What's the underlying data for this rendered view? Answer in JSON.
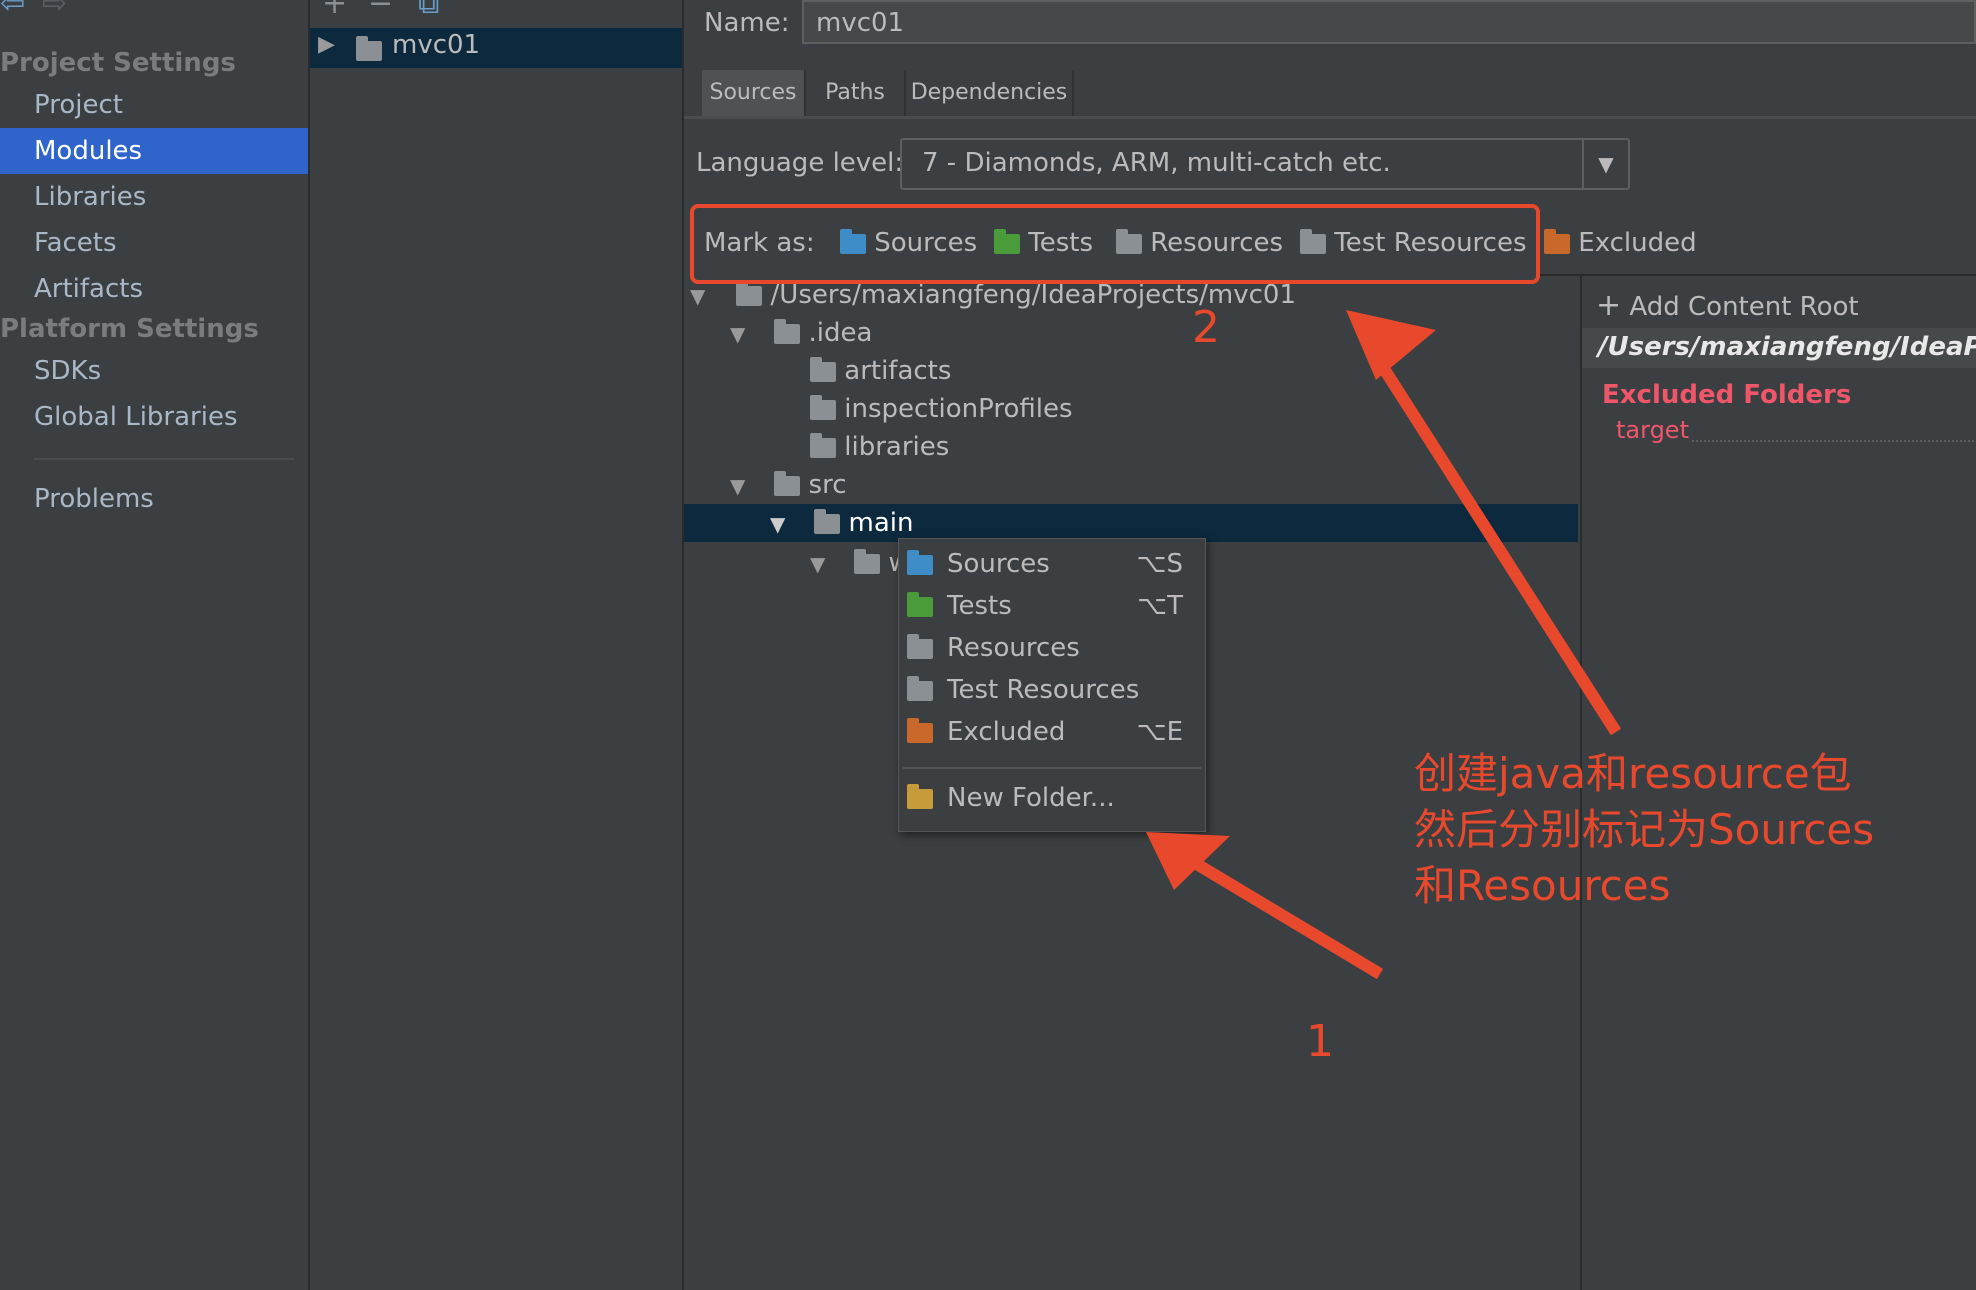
{
  "sidebar": {
    "sections": [
      {
        "title": "Project Settings",
        "items": [
          "Project",
          "Modules",
          "Libraries",
          "Facets",
          "Artifacts"
        ]
      },
      {
        "title": "Platform Settings",
        "items": [
          "SDKs",
          "Global Libraries"
        ]
      }
    ],
    "problems": "Problems",
    "selected": "Modules"
  },
  "module_list": {
    "item": "mvc01"
  },
  "header": {
    "name_label": "Name:",
    "name_value": "mvc01"
  },
  "tabs": [
    "Sources",
    "Paths",
    "Dependencies"
  ],
  "language": {
    "label": "Language level:",
    "value": "7 - Diamonds, ARM, multi-catch etc."
  },
  "mark_as": {
    "label": "Mark as:",
    "items": [
      "Sources",
      "Tests",
      "Resources",
      "Test Resources",
      "Excluded"
    ]
  },
  "tree": {
    "root": "/Users/maxiangfeng/IdeaProjects/mvc01",
    "idea": ".idea",
    "artifacts": "artifacts",
    "inspection": "inspectionProfiles",
    "libraries": "libraries",
    "src": "src",
    "main": "main",
    "w": "w"
  },
  "content_root": {
    "add": "Add Content Root",
    "path": "/Users/maxiangfeng/IdeaPro",
    "excluded_title": "Excluded Folders",
    "excluded_item": "target"
  },
  "context_menu": {
    "items": [
      {
        "label": "Sources",
        "shortcut": "⌥S"
      },
      {
        "label": "Tests",
        "shortcut": "⌥T"
      },
      {
        "label": "Resources",
        "shortcut": ""
      },
      {
        "label": "Test Resources",
        "shortcut": ""
      },
      {
        "label": "Excluded",
        "shortcut": "⌥E"
      }
    ],
    "new_folder": "New Folder..."
  },
  "annotations": {
    "text_lines": [
      "创建java和resource包",
      "然后分别标记为Sources",
      "和Resources"
    ],
    "num1": "1",
    "num2": "2",
    "color": "#e8492d"
  },
  "colors": {
    "selection": "#2f65ca",
    "tree_selection": "#0d293e",
    "background": "#3c3f41"
  }
}
